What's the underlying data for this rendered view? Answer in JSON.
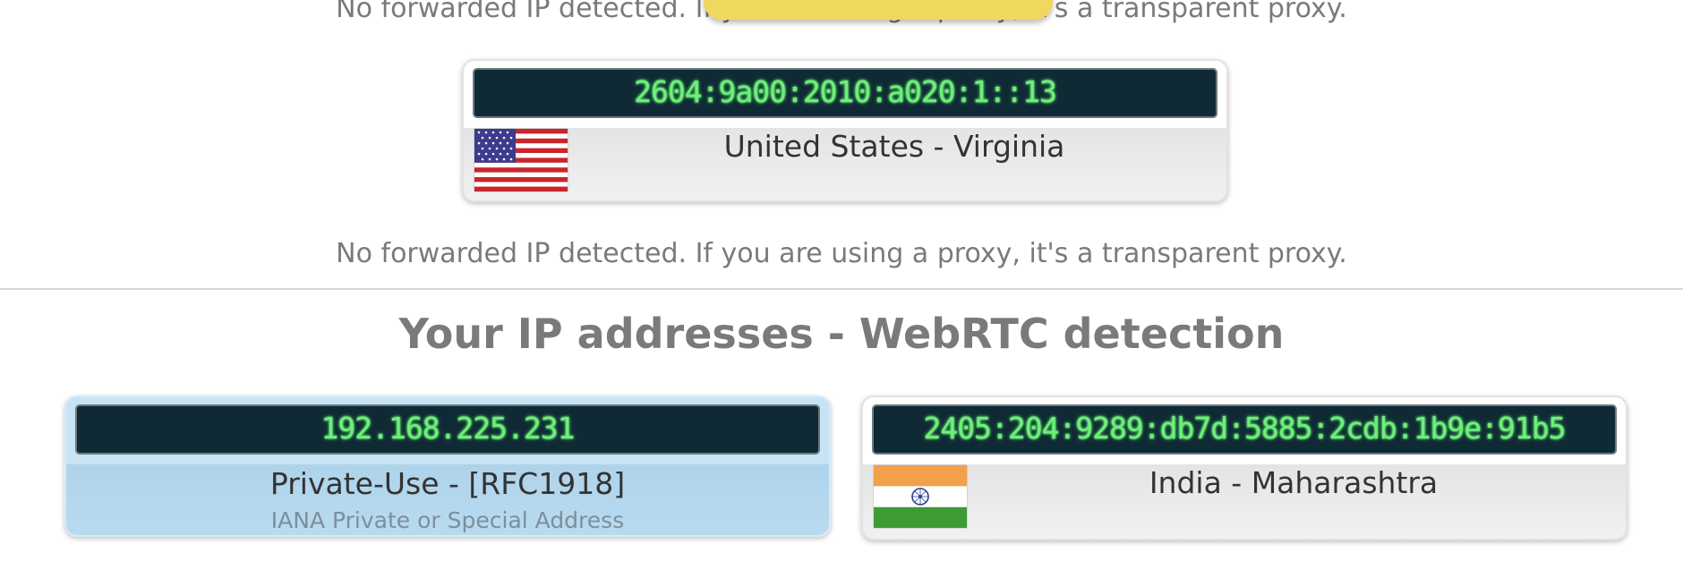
{
  "forwarded_notice_top": "No forwarded IP detected. If you are using a proxy, it's a transparent proxy.",
  "forwarded_notice": "No forwarded IP detected. If you are using a proxy, it's a transparent proxy.",
  "ipv6_card": {
    "ip": "2604:9a00:2010:a020:1::13",
    "location": "United States - Virginia",
    "flag_icon": "us-flag-icon"
  },
  "webrtc": {
    "title": "Your IP addresses - WebRTC detection",
    "private_card": {
      "ip": "192.168.225.231",
      "label": "Private-Use - [RFC1918]",
      "sublabel": "IANA Private or Special Address"
    },
    "public_card": {
      "ip": "2405:204:9289:db7d:5885:2cdb:1b9e:91b5",
      "location": "India - Maharashtra",
      "flag_icon": "india-flag-icon"
    }
  },
  "colors": {
    "ip_text": "#6df07a",
    "ip_background": "#102a35",
    "private_card_bg": "#b9dbf0",
    "heading": "#7a7a7a",
    "notice_banner": "#f0d85e"
  }
}
